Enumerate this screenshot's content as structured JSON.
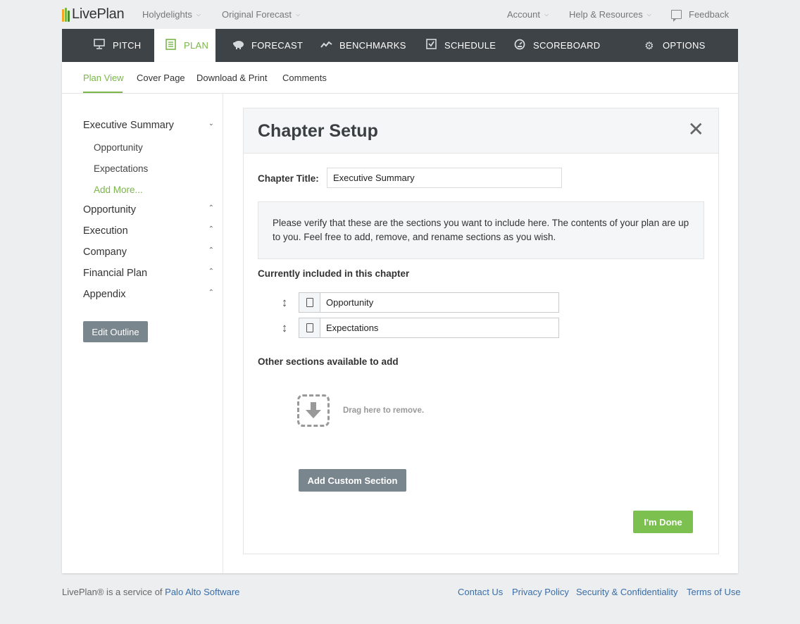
{
  "brand": {
    "name": "LivePlan",
    "bar_colors": [
      "#f5a623",
      "#7ab648",
      "#4a8f2f"
    ]
  },
  "topnav": {
    "company": "Holydelights",
    "forecast": "Original Forecast",
    "account": "Account",
    "help": "Help & Resources",
    "feedback": "Feedback"
  },
  "maintabs": [
    {
      "label": "PITCH",
      "icon": "monitor-icon"
    },
    {
      "label": "PLAN",
      "icon": "notebook-icon",
      "active": true
    },
    {
      "label": "FORECAST",
      "icon": "piggy-bank-icon"
    },
    {
      "label": "BENCHMARKS",
      "icon": "trend-line-icon"
    },
    {
      "label": "SCHEDULE",
      "icon": "checkbox-icon"
    },
    {
      "label": "SCOREBOARD",
      "icon": "gauge-icon"
    },
    {
      "label": "OPTIONS",
      "icon": "gear-icon"
    }
  ],
  "subnav": {
    "plan_view": "Plan View",
    "cover_page": "Cover Page",
    "download_print": "Download & Print",
    "comments": "Comments"
  },
  "sidebar": {
    "chapters": [
      {
        "label": "Executive Summary",
        "expanded": true
      },
      {
        "label": "Opportunity"
      },
      {
        "label": "Execution"
      },
      {
        "label": "Company"
      },
      {
        "label": "Financial Plan"
      },
      {
        "label": "Appendix"
      }
    ],
    "subsections": [
      "Opportunity",
      "Expectations"
    ],
    "add_more": "Add More...",
    "edit_outline": "Edit Outline"
  },
  "panel": {
    "title": "Chapter Setup",
    "chapter_title_label": "Chapter Title:",
    "chapter_title_value": "Executive Summary",
    "info_text": "Please verify that these are the sections you want to include here. The contents of your plan are up to you. Feel free to add, remove, and rename sections as you wish.",
    "included_heading": "Currently included in this chapter",
    "included_sections": [
      "Opportunity",
      "Expectations"
    ],
    "available_heading": "Other sections available to add",
    "drag_text": "Drag here to remove.",
    "add_custom": "Add Custom Section",
    "done": "I'm Done"
  },
  "footer": {
    "service_text": "LivePlan® is a service of",
    "company_link": "Palo Alto Software",
    "links": [
      "Contact Us",
      "Privacy Policy",
      "Security & Confidentiality",
      "Terms of Use"
    ]
  },
  "colors": {
    "accent": "#7ab648",
    "dark_nav": "#3d4347",
    "link": "#3a6da8",
    "button_gray": "#7a868e"
  }
}
